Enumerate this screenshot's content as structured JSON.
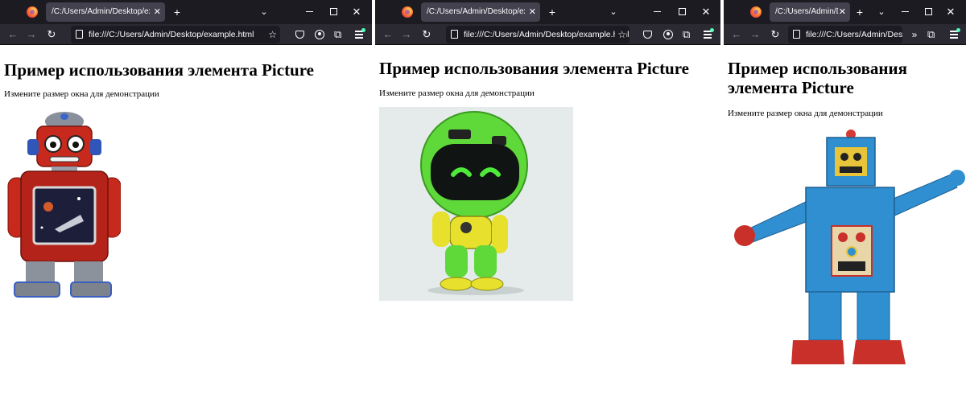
{
  "windows": [
    {
      "tab_title": "/C:/Users/Admin/Desktop/example.html",
      "url": "file:///C:/Users/Admin/Desktop/example.html",
      "heading": "Пример использования элемента Picture",
      "description": "Измените размер окна для демонстрации",
      "image": "red-tin-robot"
    },
    {
      "tab_title": "/C:/Users/Admin/Desktop/example.html",
      "url": "file:///C:/Users/Admin/Desktop/example.html",
      "heading": "Пример использования элемента Picture",
      "description": "Измените размер окна для демонстрации",
      "image": "green-cartoon-robot"
    },
    {
      "tab_title": "/C:/Users/Admin/Desktop/example.html",
      "url": "file:///C:/Users/Admin/Desktop/example.html",
      "heading": "Пример использования элемента Picture",
      "description": "Измените размер окна для демонстрации",
      "image": "blue-wooden-robot"
    }
  ],
  "icons": {
    "browser": "firefox-icon",
    "new_tab": "plus-icon",
    "tab_list": "chevron-down-icon",
    "back": "arrow-left-icon",
    "forward": "arrow-right-icon",
    "reload": "reload-icon",
    "bookmark": "star-icon",
    "pocket": "pocket-icon",
    "account": "account-icon",
    "extensions": "puzzle-icon",
    "menu": "hamburger-menu-icon",
    "overflow": "double-chevron-icon"
  },
  "colors": {
    "tab_bar": "#1c1b22",
    "toolbar": "#2b2a33",
    "active_tab": "#42414d",
    "url_field": "#1c1b22",
    "toolbar_text": "#fbfbfe"
  }
}
